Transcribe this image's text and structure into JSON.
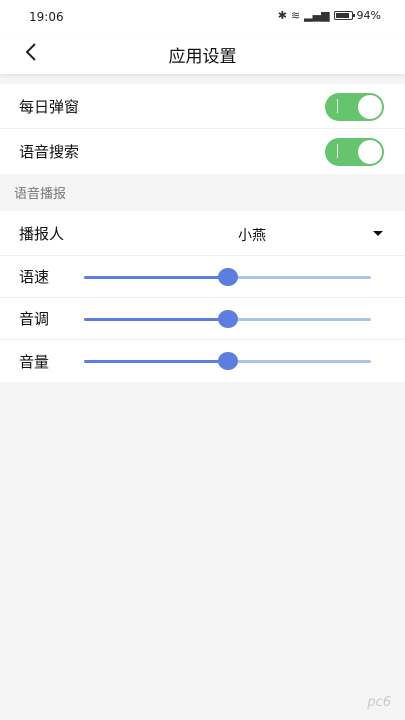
{
  "status": {
    "time": "19:06",
    "battery": "94%"
  },
  "header": {
    "title": "应用设置"
  },
  "toggles": [
    {
      "label": "每日弹窗",
      "on": true
    },
    {
      "label": "语音搜索",
      "on": true
    }
  ],
  "voice_section": {
    "title": "语音播报",
    "speaker": {
      "label": "播报人",
      "value": "小燕"
    },
    "sliders": [
      {
        "label": "语速",
        "value": 0.5
      },
      {
        "label": "音调",
        "value": 0.5
      },
      {
        "label": "音量",
        "value": 0.5
      }
    ]
  },
  "watermark": "pc6"
}
